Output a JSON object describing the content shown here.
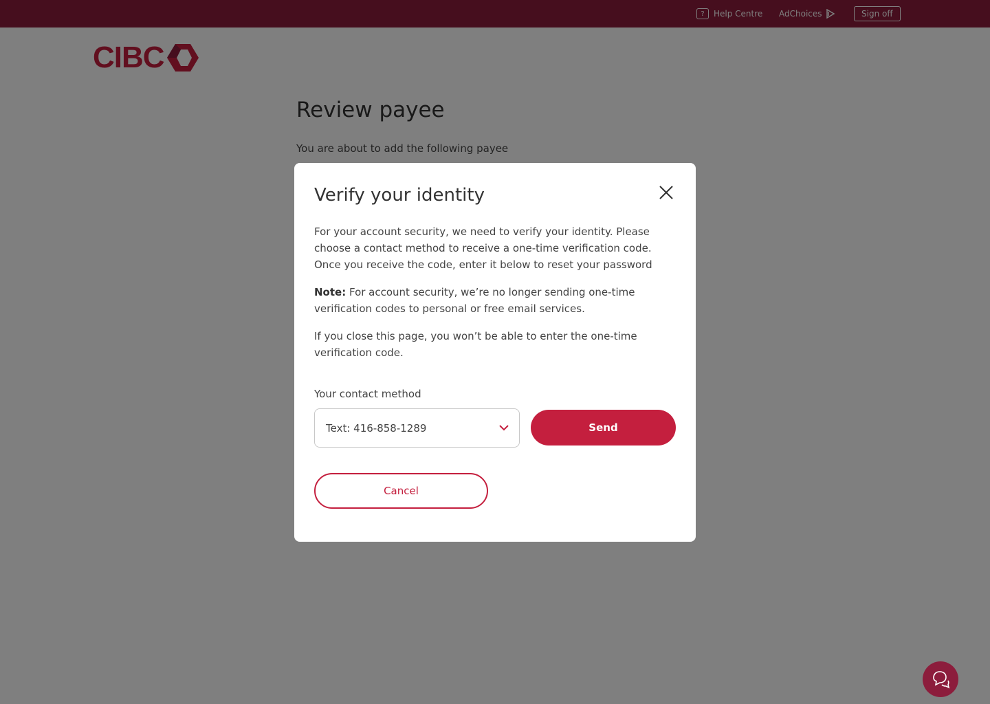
{
  "topbar": {
    "help_label": "Help Centre",
    "help_icon": "?",
    "adchoices_label": "AdChoices",
    "signoff_label": "Sign off"
  },
  "logo": {
    "text": "CIBC"
  },
  "page": {
    "title": "Review payee",
    "subtitle": "You are about to add the following payee"
  },
  "modal": {
    "title": "Verify your identity",
    "paragraph1": "For your account security, we need to verify your identity. Please choose a contact method to receive a one-time verification code. Once you receive the code, enter it below to reset your password",
    "note_label": "Note:",
    "note_text": " For account security, we’re no longer sending one-time verification codes to personal or free email services.",
    "paragraph3": "If you close this page, you won’t be able to enter the one-time verification code.",
    "contact_label": "Your contact method",
    "contact_value": "Text: 416-858-1289",
    "send_label": "Send",
    "cancel_label": "Cancel"
  },
  "colors": {
    "brand": "#c41f3e",
    "topbar": "#8c1d3c"
  }
}
